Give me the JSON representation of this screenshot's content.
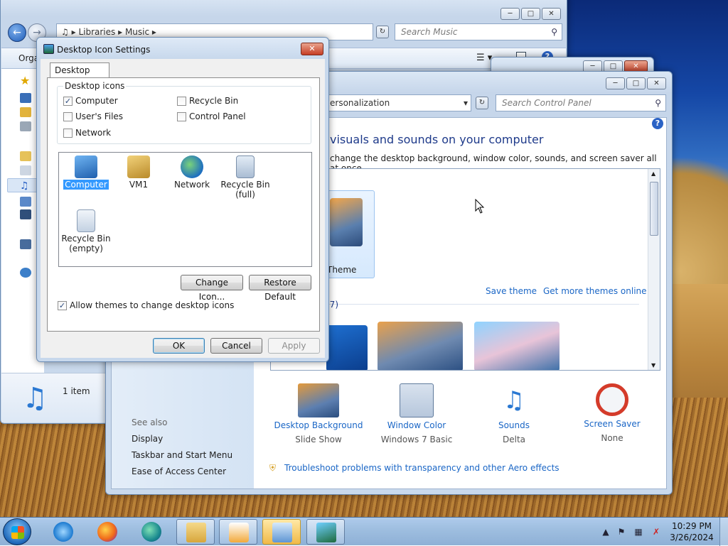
{
  "explorer": {
    "breadcrumb": [
      "Libraries",
      "Music"
    ],
    "search_placeholder": "Search Music",
    "organize_label": "Orga",
    "details_text": "1 item"
  },
  "control_panel": {
    "breadcrumb": "ersonalization",
    "search_placeholder": "Search Control Panel",
    "heading": "visuals and sounds on your computer",
    "subheading": "change the desktop background, window color, sounds, and screen saver all at once.",
    "section_mythemes_suffix": ")",
    "theme_caption": "Theme",
    "save_theme": "Save theme",
    "get_more_themes": "Get more themes online",
    "section_aero_suffix": "(7)",
    "see_also": "See also",
    "left_links": [
      "Display",
      "Taskbar and Start Menu",
      "Ease of Access Center"
    ],
    "bottom_items": [
      {
        "label": "Desktop Background",
        "sub": "Slide Show"
      },
      {
        "label": "Window Color",
        "sub": "Windows 7 Basic"
      },
      {
        "label": "Sounds",
        "sub": "Delta"
      },
      {
        "label": "Screen Saver",
        "sub": "None"
      }
    ],
    "troubleshoot": "Troubleshoot problems with transparency and other Aero effects"
  },
  "dialog": {
    "title": "Desktop Icon Settings",
    "tab": "Desktop Icons",
    "group_label": "Desktop icons",
    "checkboxes": [
      {
        "label": "Computer",
        "checked": true
      },
      {
        "label": "Recycle Bin",
        "checked": false
      },
      {
        "label": "User's Files",
        "checked": false
      },
      {
        "label": "Control Panel",
        "checked": false
      },
      {
        "label": "Network",
        "checked": false
      }
    ],
    "icons": [
      {
        "label": "Computer",
        "icon": "computer-icon",
        "selected": true
      },
      {
        "label": "VM1",
        "icon": "user-folder-icon",
        "selected": false
      },
      {
        "label": "Network",
        "icon": "network-icon",
        "selected": false
      },
      {
        "label": "Recycle Bin (full)",
        "line1": "Recycle Bin",
        "line2": "(full)",
        "icon": "recycle-bin-full-icon",
        "selected": false
      },
      {
        "label": "Recycle Bin (empty)",
        "line1": "Recycle Bin",
        "line2": "(empty)",
        "icon": "recycle-bin-empty-icon",
        "selected": false
      }
    ],
    "change_icon": "Change Icon...",
    "restore_default": "Restore Default",
    "allow_themes": "Allow themes to change desktop icons",
    "allow_themes_checked": true,
    "ok": "OK",
    "cancel": "Cancel",
    "apply": "Apply"
  },
  "taskbar": {
    "time": "10:29 PM",
    "date": "3/26/2024",
    "apps": [
      "internet-explorer-icon",
      "firefox-icon",
      "edge-icon",
      "file-explorer-icon",
      "media-player-icon",
      "control-panel-icon",
      "desktop-icon-settings-icon"
    ]
  },
  "colors": {
    "link": "#1a66c6",
    "heading": "#1e3a8a",
    "selection": "#3399ff"
  }
}
